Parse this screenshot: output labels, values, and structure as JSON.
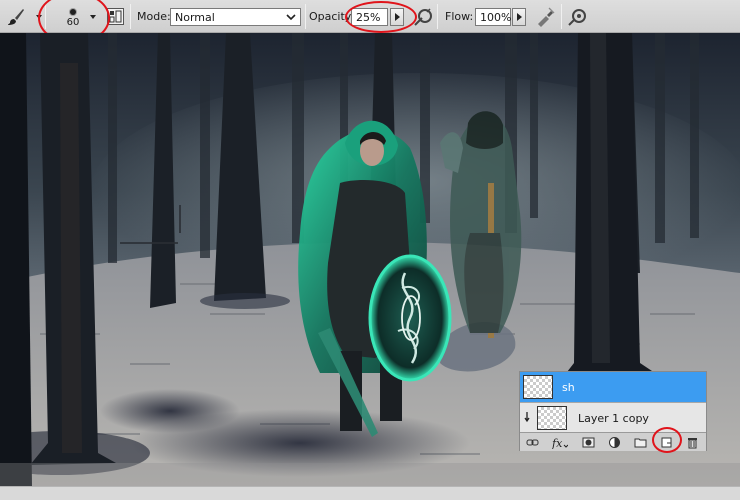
{
  "options_bar": {
    "tool_icon": "brush-icon",
    "brush_size": "60",
    "mode_label": "Mode:",
    "mode_value": "Normal",
    "opacity_label": "Opacity:",
    "opacity_value": "25%",
    "flow_label": "Flow:",
    "flow_value": "100%"
  },
  "layers_panel": {
    "layers": [
      {
        "name": "sh",
        "selected": true
      },
      {
        "name": "Layer 1 copy",
        "selected": false,
        "clipped": true
      }
    ],
    "toolbar_icons": [
      "link-layers-icon",
      "fx-icon",
      "add-mask-icon",
      "adjustment-layer-icon",
      "new-group-icon",
      "new-layer-icon",
      "delete-layer-icon"
    ]
  },
  "colors": {
    "selection": "#3c9cf1",
    "annotation": "#e0141b",
    "cloak_glow": "#1fcf9a"
  }
}
